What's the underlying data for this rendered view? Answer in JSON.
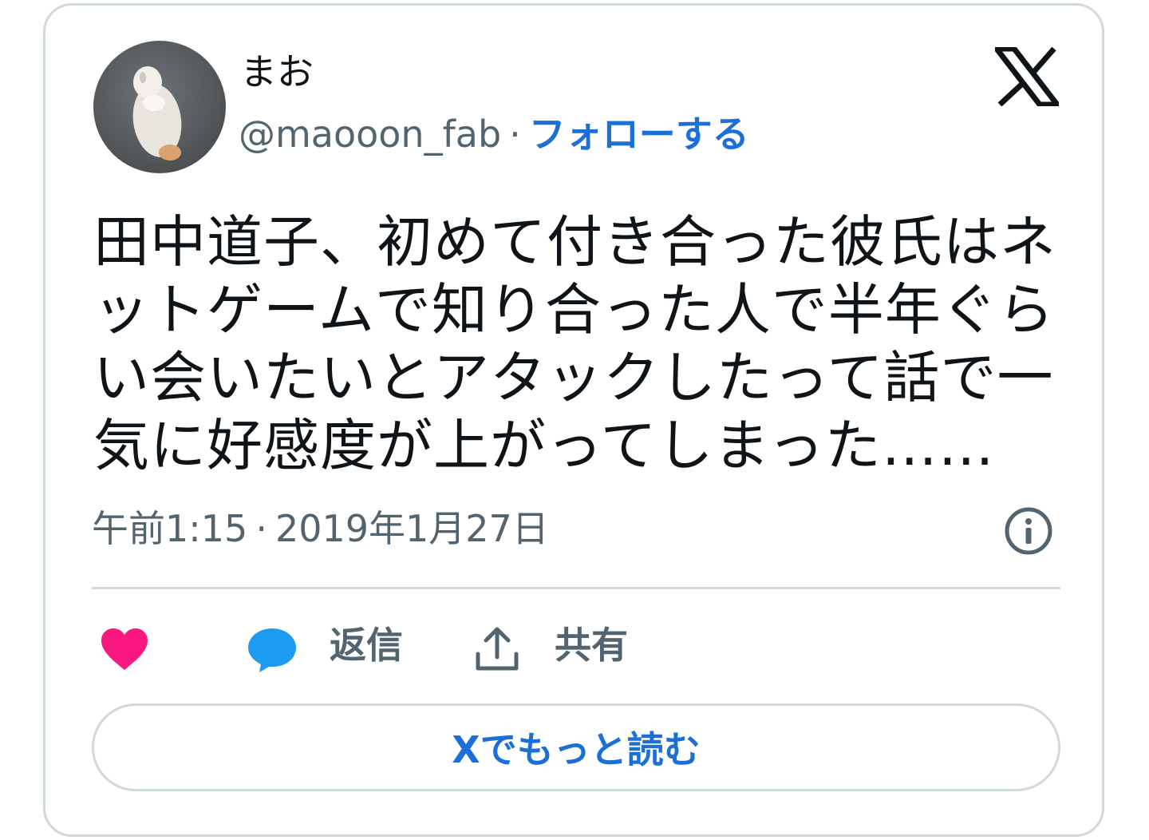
{
  "tweet": {
    "display_name": "まお",
    "handle": "@maooon_fab",
    "separator": "·",
    "follow_label": "フォローする",
    "text": "田中道子、初めて付き合った彼氏はネットゲームで知り合った人で半年ぐらい会いたいとアタックしたって話で一気に好感度が上がってしまった……",
    "time": "午前1:15",
    "date": "2019年1月27日"
  },
  "actions": {
    "like_icon": "heart-icon",
    "reply_icon": "speech-bubble-icon",
    "reply_label": "返信",
    "share_icon": "upload-share-icon",
    "share_label": "共有"
  },
  "read_more_label": "Xでもっと読む",
  "colors": {
    "accent": "#1d6fd8",
    "like": "#f91880",
    "reply": "#1d9bf0",
    "muted": "#536471",
    "text": "#0f1419",
    "border": "#cfd9de"
  }
}
